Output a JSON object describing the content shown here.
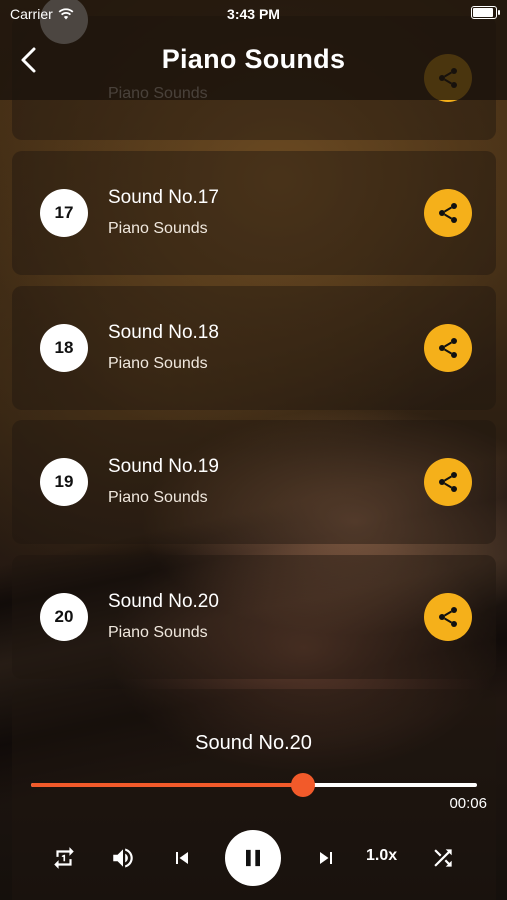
{
  "status_bar": {
    "carrier": "Carrier",
    "time": "3:43 PM"
  },
  "nav": {
    "title": "Piano Sounds",
    "back_icon": "chevron-left-icon"
  },
  "colors": {
    "accent_share": "#f5b01a",
    "progress": "#f25a2a"
  },
  "list": {
    "items": [
      {
        "number": "",
        "name": "",
        "subtitle": "Piano Sounds"
      },
      {
        "number": "17",
        "name": "Sound No.17",
        "subtitle": "Piano Sounds"
      },
      {
        "number": "18",
        "name": "Sound No.18",
        "subtitle": "Piano Sounds"
      },
      {
        "number": "19",
        "name": "Sound No.19",
        "subtitle": "Piano Sounds"
      },
      {
        "number": "20",
        "name": "Sound No.20",
        "subtitle": "Piano Sounds"
      }
    ]
  },
  "player": {
    "now_playing": "Sound No.20",
    "elapsed": "00:06",
    "progress_fraction": 0.61,
    "speed": "1.0x",
    "icons": [
      "repeat-one-icon",
      "volume-icon",
      "skip-previous-icon",
      "pause-icon",
      "skip-next-icon",
      "shuffle-icon"
    ]
  }
}
